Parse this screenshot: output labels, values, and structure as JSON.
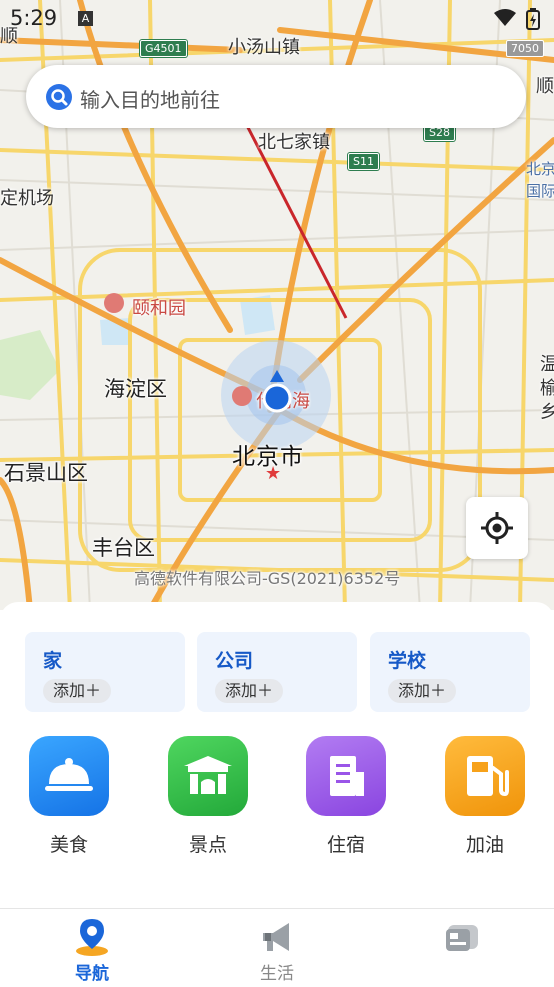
{
  "status_bar": {
    "time": "5:29",
    "notification_badge": "A"
  },
  "search": {
    "placeholder": "输入目的地前往",
    "icon": "search-icon"
  },
  "map": {
    "labels": {
      "xiaotangshan": "小汤山镇",
      "beiqijia": "北七家镇",
      "yiheyuan": "颐和园",
      "haidian": "海淀区",
      "shijingshan": "石景山区",
      "beijing": "北京市",
      "fengtai": "丰台区",
      "airport_west": "定机场",
      "airport_east_1": "北京",
      "airport_east_2": "国际",
      "left_edge": "顺",
      "right_edge_1": "顺",
      "right_edge_2": "温",
      "right_edge_3": "榆",
      "right_edge_4": "乡",
      "shichahai": "什刹海",
      "copyright": "高德软件有限公司-GS(2021)6352号"
    },
    "road_badges": {
      "g4501": "G4501",
      "s11": "S11",
      "s28": "S28",
      "code": "7050"
    }
  },
  "favorites": [
    {
      "title": "家",
      "action": "添加＋"
    },
    {
      "title": "公司",
      "action": "添加＋"
    },
    {
      "title": "学校",
      "action": "添加＋"
    }
  ],
  "categories": [
    {
      "label": "美食",
      "icon": "food-cloche-icon",
      "color": "#1e8ff5"
    },
    {
      "label": "景点",
      "icon": "landmark-gate-icon",
      "color": "#2fc24a"
    },
    {
      "label": "住宿",
      "icon": "hotel-building-icon",
      "color": "#9a55e8"
    },
    {
      "label": "加油",
      "icon": "fuel-pump-icon",
      "color": "#f7a21b"
    }
  ],
  "tabs": [
    {
      "label": "导航",
      "icon": "navigation-pin-icon",
      "active": true
    },
    {
      "label": "生活",
      "icon": "megaphone-icon",
      "active": false
    },
    {
      "label": "",
      "icon": "profile-card-icon",
      "active": false
    }
  ]
}
